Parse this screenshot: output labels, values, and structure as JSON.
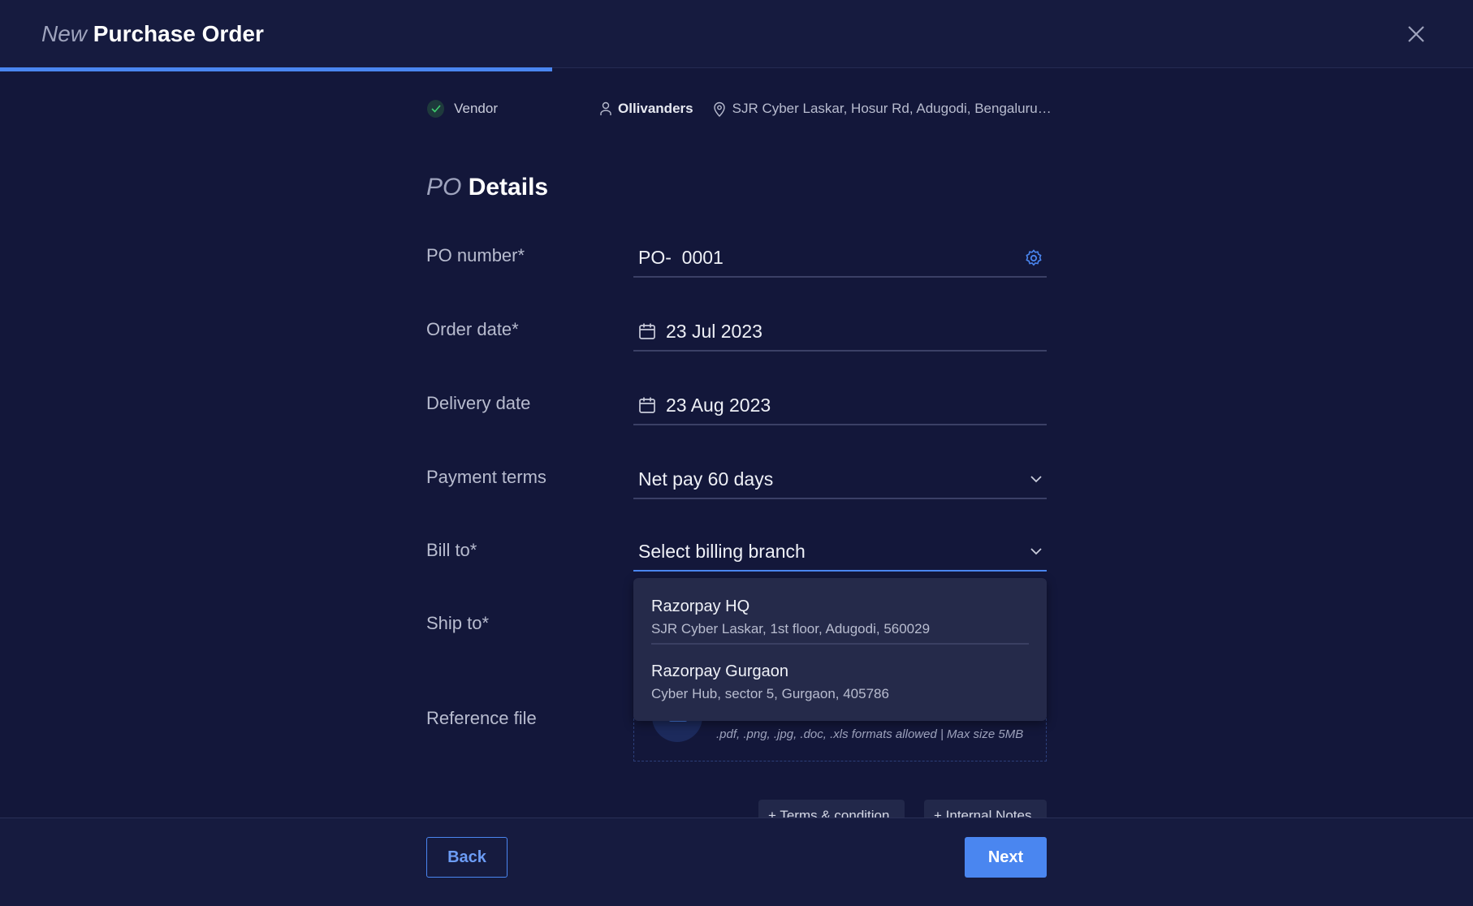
{
  "header": {
    "title_prefix": "New",
    "title": "Purchase Order",
    "progress_percent": 37.5
  },
  "vendor": {
    "step_label": "Vendor",
    "name": "Ollivanders",
    "address": "SJR Cyber Laskar, Hosur Rd, Adugodi, Bengaluru, K..."
  },
  "section": {
    "prefix": "PO",
    "title": "Details"
  },
  "fields": {
    "po_number": {
      "label": "PO number*",
      "prefix": "PO-",
      "value": "0001"
    },
    "order_date": {
      "label": "Order date*",
      "value": "23 Jul 2023"
    },
    "delivery_date": {
      "label": "Delivery date",
      "value": "23 Aug 2023"
    },
    "payment_terms": {
      "label": "Payment terms",
      "value": "Net pay 60 days"
    },
    "bill_to": {
      "label": "Bill to*",
      "placeholder": "Select billing branch"
    },
    "ship_to": {
      "label": "Ship to*"
    },
    "reference_file": {
      "label": "Reference file",
      "hint": ".pdf, .png, .jpg, .doc, .xls formats allowed |  Max size 5MB"
    }
  },
  "branches": [
    {
      "name": "Razorpay HQ",
      "address": "SJR Cyber Laskar, 1st floor, Adugodi, 560029"
    },
    {
      "name": "Razorpay Gurgaon",
      "address": "Cyber Hub, sector 5, Gurgaon, 405786"
    }
  ],
  "extras": {
    "terms": "+ Terms & condition",
    "notes": "+ Internal Notes"
  },
  "footer": {
    "back": "Back",
    "next": "Next"
  },
  "colors": {
    "accent": "#4a86f0",
    "background": "#13173a",
    "success": "#3ecf6e"
  }
}
